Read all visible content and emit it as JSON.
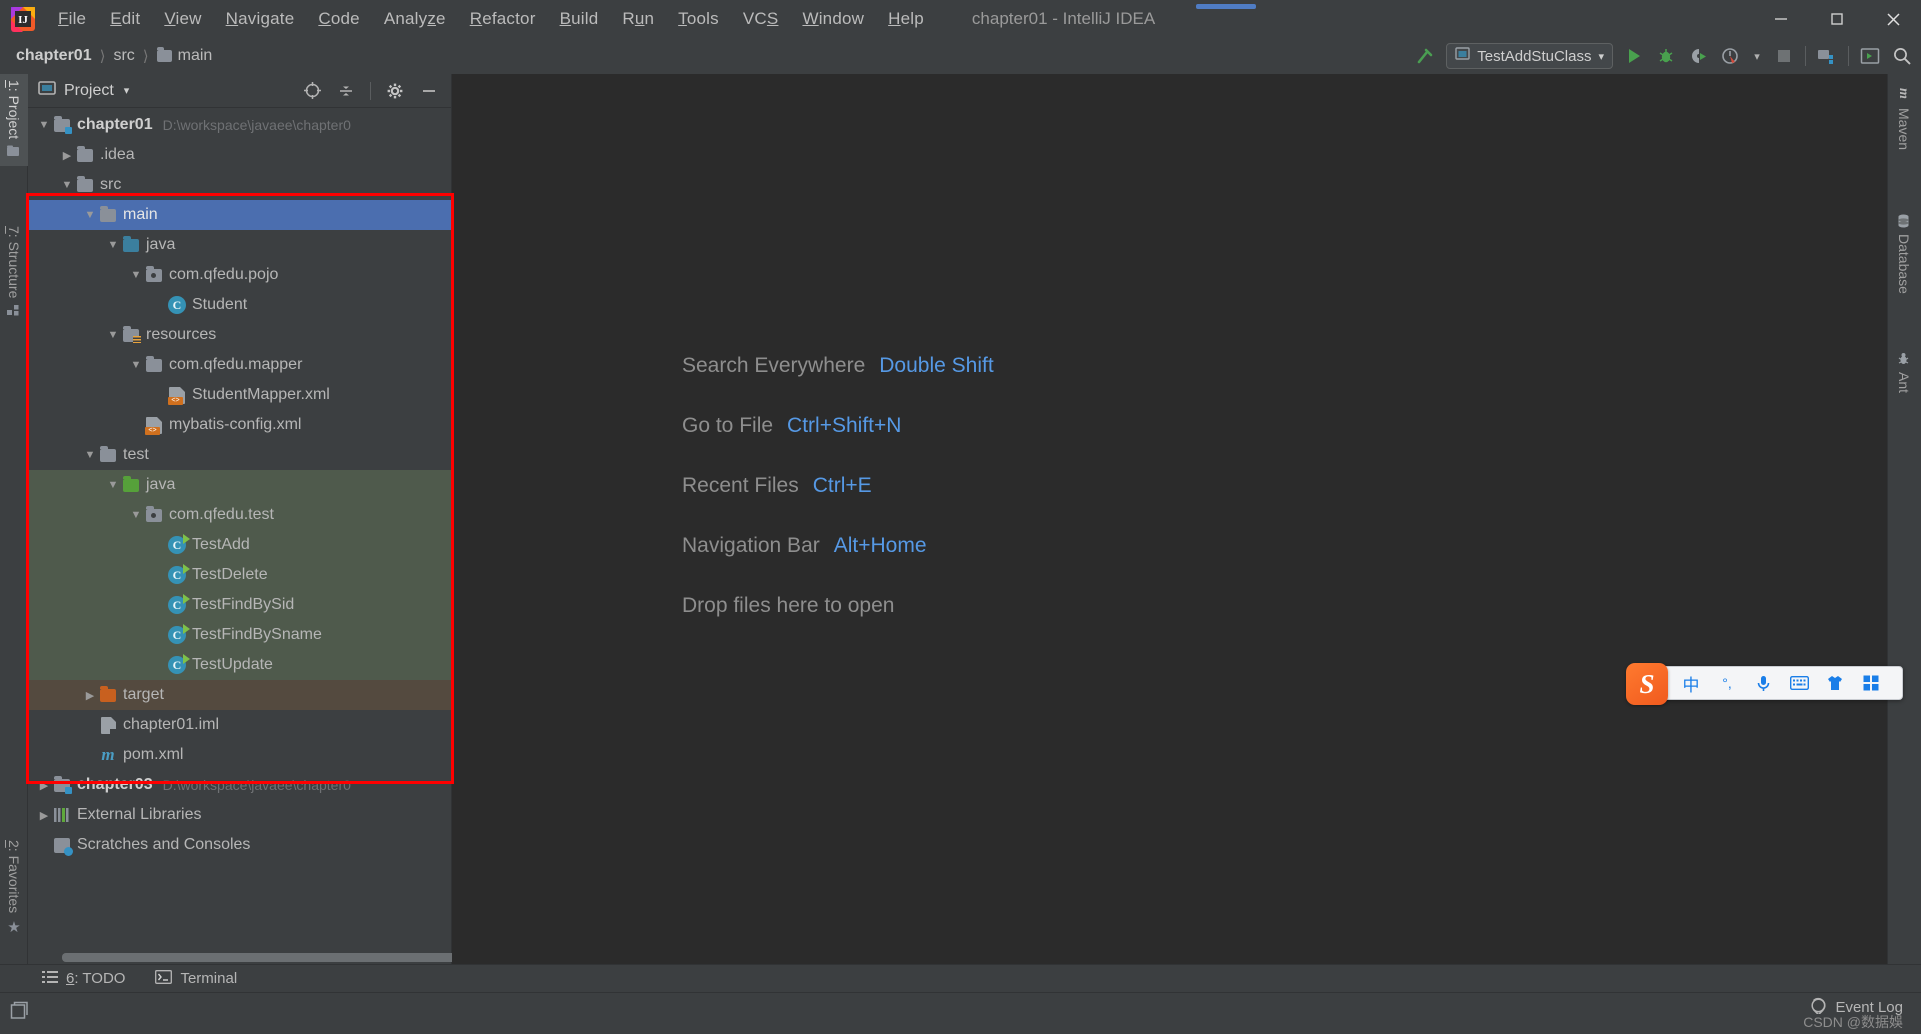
{
  "window": {
    "title": "chapter01 - IntelliJ IDEA",
    "logo_icon": "intellij-idea-logo",
    "minimize_label": "—",
    "maximize_label": "❐",
    "close_label": "✕"
  },
  "menubar": {
    "items": [
      {
        "label": "File",
        "mnemonic": "F"
      },
      {
        "label": "Edit",
        "mnemonic": "E"
      },
      {
        "label": "View",
        "mnemonic": "V"
      },
      {
        "label": "Navigate",
        "mnemonic": "N"
      },
      {
        "label": "Code",
        "mnemonic": "C"
      },
      {
        "label": "Analyze",
        "mnemonic": "z"
      },
      {
        "label": "Refactor",
        "mnemonic": "R"
      },
      {
        "label": "Build",
        "mnemonic": "B"
      },
      {
        "label": "Run",
        "mnemonic": "u"
      },
      {
        "label": "Tools",
        "mnemonic": "T"
      },
      {
        "label": "VCS",
        "mnemonic": "S"
      },
      {
        "label": "Window",
        "mnemonic": "W"
      },
      {
        "label": "Help",
        "mnemonic": "H"
      }
    ]
  },
  "navbar": {
    "breadcrumbs": [
      {
        "label": "chapter01",
        "icon": "",
        "bold": true
      },
      {
        "label": "src",
        "icon": ""
      },
      {
        "label": "main",
        "icon": "folder-icon"
      }
    ]
  },
  "toolbar": {
    "build_label": "build-hammer-icon",
    "run_config": {
      "name": "TestAddStuClass",
      "icon": "run-config-icon",
      "chevron": "▾"
    },
    "run_label": "run-icon",
    "debug_label": "debug-icon",
    "run_coverage_label": "run-with-coverage-icon",
    "profiler_label": "profiler-icon",
    "stop_label": "stop-icon",
    "project_structure_label": "project-structure-icon",
    "updates_label": "terminal-window-icon",
    "search_label": "search-icon"
  },
  "left_tool_strip": {
    "tabs": [
      {
        "label": "1: Project",
        "mnemonic": "1",
        "icon": "project-folder-icon",
        "active": true
      },
      {
        "label": "7: Structure",
        "mnemonic": "7",
        "icon": "structure-icon",
        "active": false
      },
      {
        "label": "2: Favorites",
        "mnemonic": "2",
        "icon": "star-icon",
        "active": false
      }
    ]
  },
  "right_tool_strip": {
    "tabs": [
      {
        "label": "Maven",
        "icon": "maven-icon"
      },
      {
        "label": "Database",
        "icon": "database-icon"
      },
      {
        "label": "Ant",
        "icon": "ant-icon"
      }
    ]
  },
  "project_panel": {
    "title": "Project",
    "title_chevron": "▾",
    "header_icons": [
      {
        "name": "locate-icon",
        "glyph": "⊕"
      },
      {
        "name": "collapse-all-icon",
        "glyph": "⇵"
      },
      {
        "name": "settings-gear-icon",
        "glyph": "⚙"
      },
      {
        "name": "hide-panel-icon",
        "glyph": "—"
      }
    ],
    "tree": [
      {
        "label": "chapter01",
        "sub": "D:\\workspace\\javaee\\chapter0",
        "arrow": "▼",
        "icon": "module-folder-icon",
        "indent": 0,
        "bold": true,
        "state": "normal"
      },
      {
        "label": ".idea",
        "sub": "",
        "arrow": "▶",
        "icon": "folder-icon",
        "indent": 1,
        "bold": false,
        "state": "normal"
      },
      {
        "label": "src",
        "sub": "",
        "arrow": "▼",
        "icon": "folder-icon",
        "indent": 1,
        "bold": false,
        "state": "normal"
      },
      {
        "label": "main",
        "sub": "",
        "arrow": "▼",
        "icon": "folder-icon",
        "indent": 2,
        "bold": false,
        "state": "selected"
      },
      {
        "label": "java",
        "sub": "",
        "arrow": "▼",
        "icon": "source-folder-icon",
        "indent": 3,
        "bold": false,
        "state": "normal"
      },
      {
        "label": "com.qfedu.pojo",
        "sub": "",
        "arrow": "▼",
        "icon": "package-icon",
        "indent": 4,
        "bold": false,
        "state": "normal"
      },
      {
        "label": "Student",
        "sub": "",
        "arrow": "",
        "icon": "java-class-icon",
        "indent": 5,
        "bold": false,
        "state": "normal"
      },
      {
        "label": "resources",
        "sub": "",
        "arrow": "▼",
        "icon": "resources-folder-icon",
        "indent": 3,
        "bold": false,
        "state": "normal"
      },
      {
        "label": "com.qfedu.mapper",
        "sub": "",
        "arrow": "▼",
        "icon": "folder-icon",
        "indent": 4,
        "bold": false,
        "state": "normal"
      },
      {
        "label": "StudentMapper.xml",
        "sub": "",
        "arrow": "",
        "icon": "xml-file-icon",
        "indent": 5,
        "bold": false,
        "state": "normal"
      },
      {
        "label": "mybatis-config.xml",
        "sub": "",
        "arrow": "",
        "icon": "xml-file-icon",
        "indent": 4,
        "bold": false,
        "state": "normal"
      },
      {
        "label": "test",
        "sub": "",
        "arrow": "▼",
        "icon": "folder-icon",
        "indent": 2,
        "bold": false,
        "state": "normal"
      },
      {
        "label": "java",
        "sub": "",
        "arrow": "▼",
        "icon": "test-source-folder-icon",
        "indent": 3,
        "bold": false,
        "state": "testsrc"
      },
      {
        "label": "com.qfedu.test",
        "sub": "",
        "arrow": "▼",
        "icon": "package-icon",
        "indent": 4,
        "bold": false,
        "state": "testsrc"
      },
      {
        "label": "TestAdd",
        "sub": "",
        "arrow": "",
        "icon": "runnable-java-class-icon",
        "indent": 5,
        "bold": false,
        "state": "testsrc"
      },
      {
        "label": "TestDelete",
        "sub": "",
        "arrow": "",
        "icon": "runnable-java-class-icon",
        "indent": 5,
        "bold": false,
        "state": "testsrc"
      },
      {
        "label": "TestFindBySid",
        "sub": "",
        "arrow": "",
        "icon": "runnable-java-class-icon",
        "indent": 5,
        "bold": false,
        "state": "testsrc"
      },
      {
        "label": "TestFindBySname",
        "sub": "",
        "arrow": "",
        "icon": "runnable-java-class-icon",
        "indent": 5,
        "bold": false,
        "state": "testsrc"
      },
      {
        "label": "TestUpdate",
        "sub": "",
        "arrow": "",
        "icon": "runnable-java-class-icon",
        "indent": 5,
        "bold": false,
        "state": "testsrc"
      },
      {
        "label": "target",
        "sub": "",
        "arrow": "▶",
        "icon": "excluded-folder-icon",
        "indent": 2,
        "bold": false,
        "state": "excluded"
      },
      {
        "label": "chapter01.iml",
        "sub": "",
        "arrow": "",
        "icon": "iml-file-icon",
        "indent": 2,
        "bold": false,
        "state": "normal"
      },
      {
        "label": "pom.xml",
        "sub": "",
        "arrow": "",
        "icon": "maven-pom-icon",
        "indent": 2,
        "bold": false,
        "state": "normal"
      },
      {
        "label": "chapter03",
        "sub": "D:\\workspace\\javaee\\chapter0",
        "arrow": "▶",
        "icon": "module-folder-icon",
        "indent": 0,
        "bold": true,
        "state": "normal"
      },
      {
        "label": "External Libraries",
        "sub": "",
        "arrow": "▶",
        "icon": "external-libraries-icon",
        "indent": 0,
        "bold": false,
        "state": "normal"
      },
      {
        "label": "Scratches and Consoles",
        "sub": "",
        "arrow": "",
        "icon": "scratches-icon",
        "indent": 0,
        "bold": false,
        "state": "normal"
      }
    ]
  },
  "editor": {
    "tips": [
      {
        "name": "Search Everywhere",
        "key": "Double Shift"
      },
      {
        "name": "Go to File",
        "key": "Ctrl+Shift+N"
      },
      {
        "name": "Recent Files",
        "key": "Ctrl+E"
      },
      {
        "name": "Navigation Bar",
        "key": "Alt+Home"
      },
      {
        "name": "Drop files here to open",
        "key": ""
      }
    ]
  },
  "ime_bar": {
    "logo": "sogou-logo-icon",
    "buttons": [
      {
        "name": "chinese-mode-icon",
        "glyph": "中"
      },
      {
        "name": "punctuation-icon",
        "glyph": "°,"
      },
      {
        "name": "voice-input-icon",
        "glyph": "Ἲ4"
      },
      {
        "name": "soft-keyboard-icon",
        "glyph": "⌨"
      },
      {
        "name": "skin-icon",
        "glyph": "ὅ5"
      },
      {
        "name": "toolbox-icon",
        "glyph": "▣"
      }
    ]
  },
  "toolwindow_bar": {
    "items": [
      {
        "label": "6: TODO",
        "mnemonic": "6",
        "icon": "todo-icon"
      },
      {
        "label": "Terminal",
        "mnemonic": "",
        "icon": "terminal-icon"
      }
    ]
  },
  "statusbar": {
    "event_log": "Event Log",
    "event_log_icon": "event-log-icon",
    "memory_icon": "memory-indicator-icon",
    "watermark": "CSDN @数据娛"
  },
  "colors": {
    "accent_blue": "#4b6eaf",
    "link_blue": "#5699e5",
    "test_source_green": "#4f5a4c",
    "excluded_brown": "#544a3f",
    "annotation_red": "#ff0000",
    "editor_bg": "#2b2b2b",
    "panel_bg": "#3c3f41"
  }
}
